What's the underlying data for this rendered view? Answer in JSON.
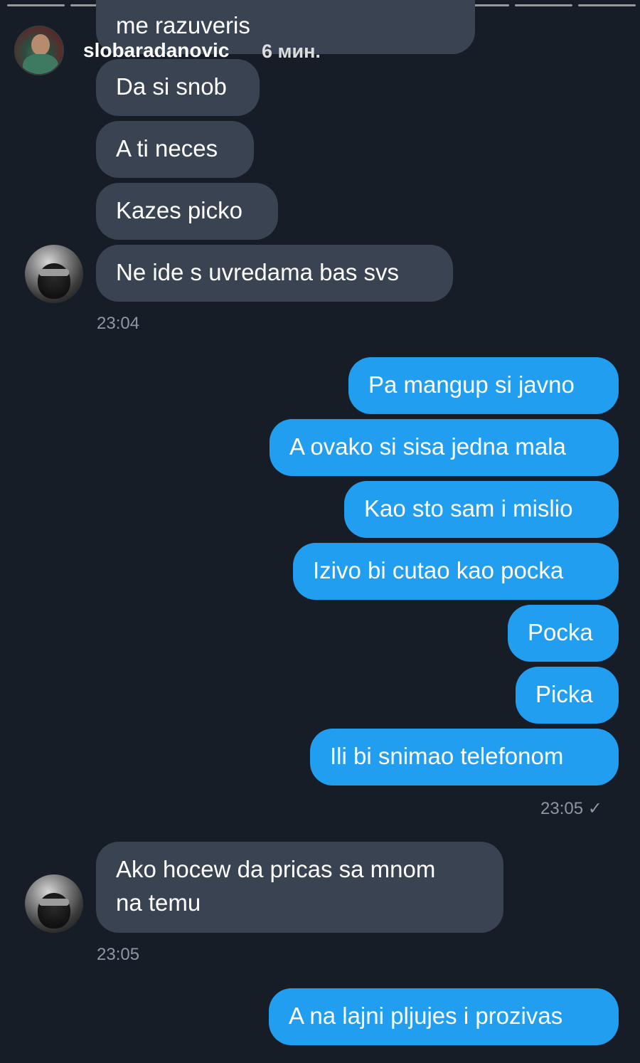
{
  "story": {
    "username": "slobaradanovic",
    "time_ago": "6 мин."
  },
  "messages": {
    "in1": {
      "text": "me razuveris"
    },
    "in2": {
      "text": "Da si snob"
    },
    "in3": {
      "text": "A ti neces"
    },
    "in4": {
      "text": "Kazes picko"
    },
    "in5": {
      "text": "Ne ide s uvredama bas svs"
    },
    "time1": "23:04",
    "out1": {
      "text": "Pa mangup si javno"
    },
    "out2": {
      "text": "A ovako si sisa jedna mala"
    },
    "out3": {
      "text": "Kao sto sam i mislio"
    },
    "out4": {
      "text": "Izivo bi cutao kao pocka"
    },
    "out5": {
      "text": "Pocka"
    },
    "out6": {
      "text": "Picka"
    },
    "out7": {
      "text": "Ili bi snimao telefonom"
    },
    "time2": "23:05",
    "read_mark": "✓",
    "in6": {
      "line1": "Ako hocew da pricas sa mnom",
      "line2": "na temu"
    },
    "time3": "23:05",
    "out8": {
      "text": "A na lajni pljujes i prozivas"
    }
  },
  "colors": {
    "background": "#161d27",
    "incoming_bubble": "#3a4352",
    "outgoing_bubble": "#229ef0",
    "timestamp": "#8e96a3"
  },
  "icons": {
    "avatar_story": "user-avatar-icon",
    "avatar_contact": "contact-avatar-icon",
    "read_receipt": "check-icon"
  }
}
